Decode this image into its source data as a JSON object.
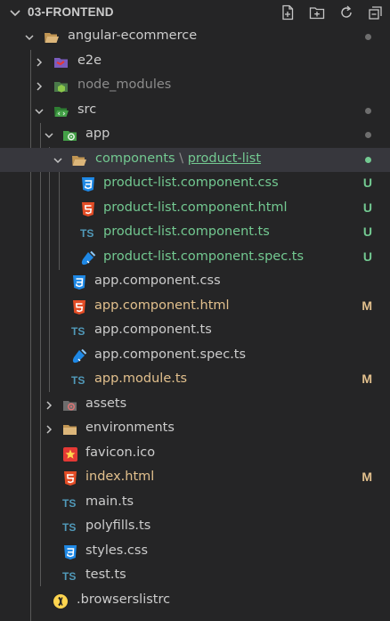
{
  "header": {
    "title": "03-FRONTEND",
    "actions": [
      "new-file-icon",
      "new-folder-icon",
      "refresh-icon",
      "collapse-all-icon"
    ]
  },
  "colors": {
    "untracked": "#73c991",
    "modified": "#e2c08d",
    "ignored": "#8c8c8c",
    "default": "#cccccc",
    "selected_bg": "#37373d"
  },
  "tree": {
    "angular_ecommerce": "angular-ecommerce",
    "e2e": "e2e",
    "node_modules": "node_modules",
    "src": "src",
    "app": "app",
    "components_a": "components",
    "components_sep": "\\",
    "components_b": "product-list",
    "pl_css": "product-list.component.css",
    "pl_html": "product-list.component.html",
    "pl_ts": "product-list.component.ts",
    "pl_spec": "product-list.component.spec.ts",
    "app_css": "app.component.css",
    "app_html": "app.component.html",
    "app_ts": "app.component.ts",
    "app_spec": "app.component.spec.ts",
    "app_module": "app.module.ts",
    "assets": "assets",
    "environments": "environments",
    "favicon": "favicon.ico",
    "index_html": "index.html",
    "main_ts": "main.ts",
    "polyfills": "polyfills.ts",
    "styles": "styles.css",
    "test_ts": "test.ts",
    "browserslist": ".browserslistrc",
    "ts_badge": "TS",
    "u": "U",
    "m": "M"
  }
}
